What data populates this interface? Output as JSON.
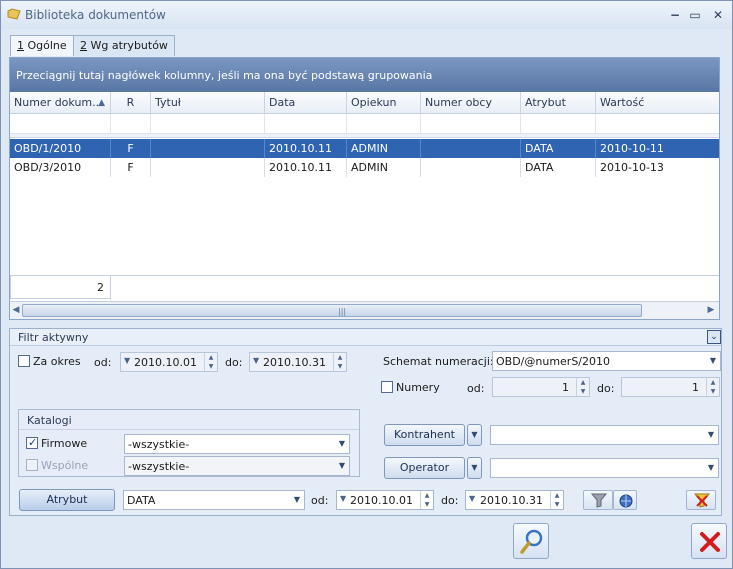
{
  "window": {
    "title": "Biblioteka dokumentów",
    "minimize": "−",
    "maximize": "▭",
    "close": "✕"
  },
  "tabs": [
    {
      "num": "1",
      "label": " Ogólne"
    },
    {
      "num": "2",
      "label": " Wg atrybutów"
    }
  ],
  "grid": {
    "group_hint": "Przeciągnij tutaj nagłówek kolumny, jeśli ma ona być podstawą grupowania",
    "columns": [
      "Numer dokum...",
      "R",
      "Tytuł",
      "Data",
      "Opiekun",
      "Numer obcy",
      "Atrybut",
      "Wartość"
    ],
    "sort_indicator": "▲",
    "rows": [
      [
        "OBD/1/2010",
        "F",
        "",
        "2010.10.11",
        "ADMIN",
        "",
        "DATA",
        "2010-10-11"
      ],
      [
        "OBD/3/2010",
        "F",
        "",
        "2010.10.11",
        "ADMIN",
        "",
        "DATA",
        "2010-10-13"
      ]
    ],
    "count": "2"
  },
  "filter": {
    "title": "Filtr aktywny",
    "za_okres": "Za okres",
    "od_label": "od:",
    "do_label": "do:",
    "okres_od": "2010.10.01",
    "okres_do": "2010.10.31",
    "schemat_label": "Schemat numeracji:",
    "schemat_value": "OBD/@numerS/2010",
    "numery_label": "Numery",
    "numery_od": "1",
    "numery_do": "1",
    "katalogi_title": "Katalogi",
    "firmowe_label": "Firmowe",
    "firmowe_value": "-wszystkie-",
    "wspolne_label": "Wspólne",
    "wspolne_value": "-wszystkie-",
    "kontrahent_btn": "Kontrahent",
    "operator_btn": "Operator",
    "atrybut_btn": "Atrybut",
    "atrybut_value": "DATA",
    "atrybut_od": "2010.10.01",
    "atrybut_do": "2010.10.31"
  }
}
